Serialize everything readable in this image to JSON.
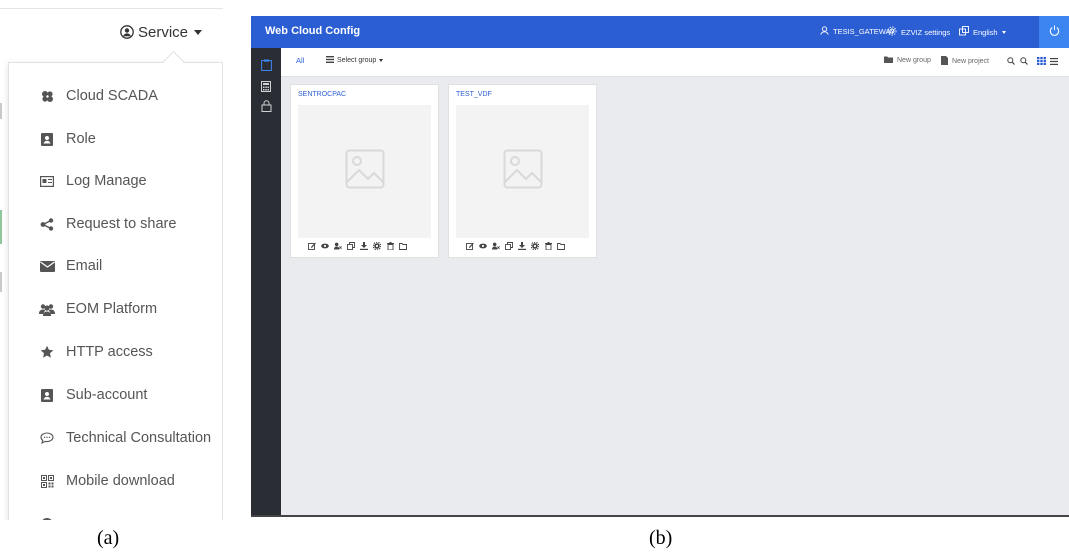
{
  "panel_a": {
    "service_button": {
      "label": "Service",
      "icon": "user-circle-icon"
    },
    "menu_items": [
      {
        "label": "Cloud SCADA",
        "icon": "cloud-scada-icon"
      },
      {
        "label": "Role",
        "icon": "role-card-icon"
      },
      {
        "label": "Log Manage",
        "icon": "log-manage-icon"
      },
      {
        "label": "Request to share",
        "icon": "share-icon"
      },
      {
        "label": "Email",
        "icon": "envelope-icon"
      },
      {
        "label": "EOM Platform",
        "icon": "users-icon"
      },
      {
        "label": "HTTP access",
        "icon": "star-icon"
      },
      {
        "label": "Sub-account",
        "icon": "sub-account-icon"
      },
      {
        "label": "Technical Consultation",
        "icon": "chat-bubble-icon"
      },
      {
        "label": "Mobile download",
        "icon": "qr-code-icon"
      }
    ],
    "caption": "(a)"
  },
  "panel_b": {
    "brand": "Web Cloud Config",
    "topbar": {
      "user": "TESIS_GATEWAY",
      "settings": "EZVIZ settings",
      "language": "English"
    },
    "toolbar": {
      "tab_all": "All",
      "select_group": "Select group",
      "new_group": "New group",
      "new_project": "New project"
    },
    "projects": [
      {
        "name": "SENTROCPAC"
      },
      {
        "name": "TEST_VDF"
      }
    ],
    "card_actions": [
      "edit-icon",
      "view-icon",
      "user-remove-icon",
      "copy-icon",
      "download-icon",
      "settings-icon",
      "delete-icon",
      "folder-icon"
    ],
    "caption": "(b)",
    "colors": {
      "topbar": "#2b5ed3",
      "sidebar": "#2a2d33",
      "canvas": "#e9ebee",
      "power": "#3c84f0"
    }
  }
}
